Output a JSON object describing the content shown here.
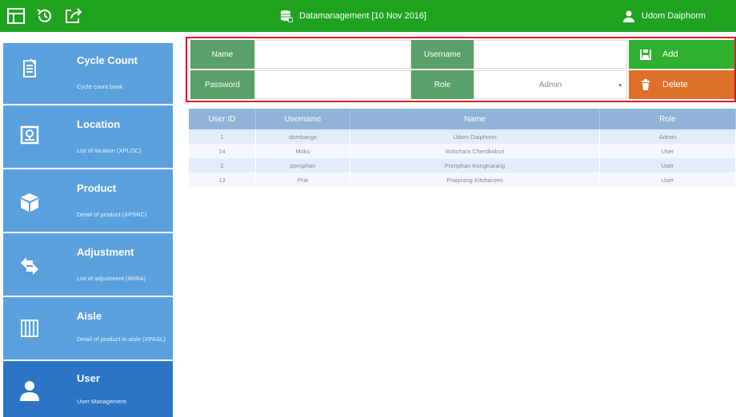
{
  "topbar": {
    "title": "Datamanagement [10 Nov 2016]",
    "user_name": "Udom Daiphorm",
    "color": "#1fa31f"
  },
  "sidebar": {
    "items": [
      {
        "title": "Cycle Count",
        "subtitle": "Cycle count book",
        "icon": "clipboard-icon",
        "active": false
      },
      {
        "title": "Location",
        "subtitle": "List of location (XPLOC)",
        "icon": "location-icon",
        "active": false
      },
      {
        "title": "Product",
        "subtitle": "Detail of product (XPSRC)",
        "icon": "box-icon",
        "active": false
      },
      {
        "title": "Adjustment",
        "subtitle": "List of adjustment (IRIRA)",
        "icon": "adjust-arrows-icon",
        "active": false
      },
      {
        "title": "Aisle",
        "subtitle": "Detail of product in aisle (XPASL)",
        "icon": "aisle-icon",
        "active": false
      },
      {
        "title": "User",
        "subtitle": "User Management",
        "icon": "user-icon",
        "active": true
      }
    ]
  },
  "form": {
    "name_label": "Name",
    "username_label": "Username",
    "password_label": "Password",
    "role_label": "Role",
    "name_value": "",
    "username_value": "",
    "password_value": "",
    "role_value": "Admin",
    "add_label": "Add",
    "delete_label": "Delete"
  },
  "table": {
    "headers": [
      "User ID",
      "Username",
      "Name",
      "Role"
    ],
    "rows": [
      {
        "id": "1",
        "username": "dombangs",
        "name": "Udom Daiphorm",
        "role": "Admin"
      },
      {
        "id": "14",
        "username": "Moku",
        "name": "Watchara Cherdkoksri",
        "role": "User"
      },
      {
        "id": "2",
        "username": "pornphan",
        "name": "Pornphan KongKaning",
        "role": "User"
      },
      {
        "id": "13",
        "username": "Prai",
        "name": "Praiprang Kitcharoen",
        "role": "User"
      }
    ]
  }
}
